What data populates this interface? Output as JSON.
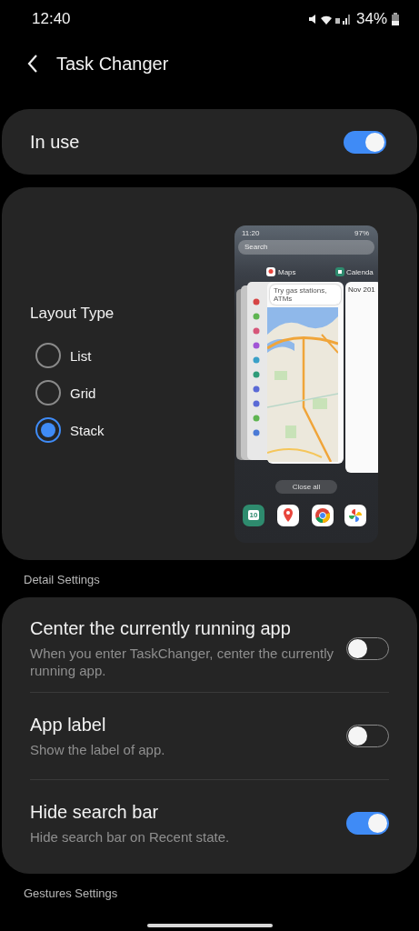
{
  "status_bar": {
    "time": "12:40",
    "battery": "34%"
  },
  "header": {
    "title": "Task Changer"
  },
  "in_use": {
    "label": "In use",
    "on": true
  },
  "layout_type": {
    "title": "Layout Type",
    "options": [
      {
        "label": "List",
        "selected": false
      },
      {
        "label": "Grid",
        "selected": false
      },
      {
        "label": "Stack",
        "selected": true
      }
    ],
    "preview": {
      "time": "11:20",
      "battery": "97%",
      "search": {
        "placeholder": "Search"
      },
      "apps": [
        {
          "label": "Maps"
        },
        {
          "label": "Calenda"
        }
      ],
      "maps_search": "Try gas stations, ATMs",
      "calendar_month": "Nov 201",
      "close_all": "Close all",
      "dock_calendar_day": "10"
    }
  },
  "detail_section": {
    "title": "Detail Settings",
    "items": [
      {
        "title": "Center the currently running app",
        "description": "When you enter TaskChanger, center the currently running app.",
        "on": false
      },
      {
        "title": "App label",
        "description": "Show the label of app.",
        "on": false
      },
      {
        "title": "Hide search bar",
        "description": "Hide search bar on Recent state.",
        "on": true
      }
    ]
  },
  "gestures_section": {
    "title": "Gestures Settings"
  }
}
